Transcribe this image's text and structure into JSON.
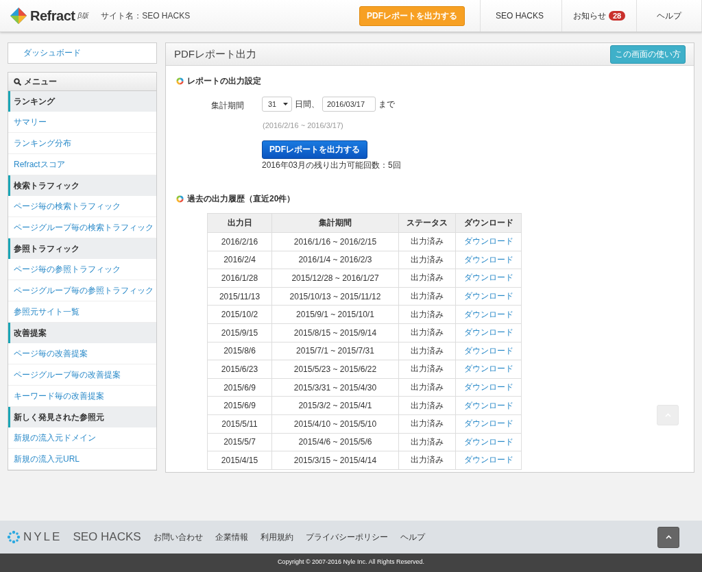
{
  "header": {
    "logo": "Refract",
    "edition": "β版",
    "site_label": "サイト名：SEO HACKS",
    "export_button": "PDFレポートを出力する",
    "nav": [
      {
        "label": "SEO HACKS",
        "kind": "dropdown"
      },
      {
        "label": "お知らせ",
        "kind": "badge",
        "badge": "28"
      },
      {
        "label": "ヘルプ",
        "kind": "plain"
      }
    ]
  },
  "sidebar": {
    "dashboard": "ダッシュボード",
    "menu_title": "メニュー",
    "sections": [
      {
        "title": "ランキング",
        "items": [
          "サマリー",
          "ランキング分布",
          "Refractスコア"
        ]
      },
      {
        "title": "検索トラフィック",
        "items": [
          "ページ毎の検索トラフィック",
          "ページグループ毎の検索トラフィック"
        ]
      },
      {
        "title": "参照トラフィック",
        "items": [
          "ページ毎の参照トラフィック",
          "ページグループ毎の参照トラフィック",
          "参照元サイト一覧"
        ]
      },
      {
        "title": "改善提案",
        "items": [
          "ページ毎の改善提案",
          "ページグループ毎の改善提案",
          "キーワード毎の改善提案"
        ]
      },
      {
        "title": "新しく発見された参照元",
        "items": [
          "新規の流入元ドメイン",
          "新規の流入元URL"
        ]
      }
    ]
  },
  "main": {
    "title": "PDFレポート出力",
    "help_button": "この画面の使い方",
    "settings": {
      "heading": "レポートの出力設定",
      "period_label": "集計期間",
      "days": "31",
      "days_suffix": "日間、",
      "date": "2016/03/17",
      "date_suffix": "まで",
      "range": "(2016/2/16 ~ 2016/3/17)",
      "button": "PDFレポートを出力する",
      "remaining": "2016年03月の残り出力可能回数：5回"
    },
    "history": {
      "heading": "過去の出力履歴（直近20件）",
      "columns": [
        "出力日",
        "集計期間",
        "ステータス",
        "ダウンロード"
      ],
      "rows": [
        [
          "2016/2/16",
          "2016/1/16 ~ 2016/2/15",
          "出力済み",
          "ダウンロード"
        ],
        [
          "2016/2/4",
          "2016/1/4 ~ 2016/2/3",
          "出力済み",
          "ダウンロード"
        ],
        [
          "2016/1/28",
          "2015/12/28 ~ 2016/1/27",
          "出力済み",
          "ダウンロード"
        ],
        [
          "2015/11/13",
          "2015/10/13 ~ 2015/11/12",
          "出力済み",
          "ダウンロード"
        ],
        [
          "2015/10/2",
          "2015/9/1 ~ 2015/10/1",
          "出力済み",
          "ダウンロード"
        ],
        [
          "2015/9/15",
          "2015/8/15 ~ 2015/9/14",
          "出力済み",
          "ダウンロード"
        ],
        [
          "2015/8/6",
          "2015/7/1 ~ 2015/7/31",
          "出力済み",
          "ダウンロード"
        ],
        [
          "2015/6/23",
          "2015/5/23 ~ 2015/6/22",
          "出力済み",
          "ダウンロード"
        ],
        [
          "2015/6/9",
          "2015/3/31 ~ 2015/4/30",
          "出力済み",
          "ダウンロード"
        ],
        [
          "2015/6/9",
          "2015/3/2 ~ 2015/4/1",
          "出力済み",
          "ダウンロード"
        ],
        [
          "2015/5/11",
          "2015/4/10 ~ 2015/5/10",
          "出力済み",
          "ダウンロード"
        ],
        [
          "2015/5/7",
          "2015/4/6 ~ 2015/5/6",
          "出力済み",
          "ダウンロード"
        ],
        [
          "2015/4/15",
          "2015/3/15 ~ 2015/4/14",
          "出力済み",
          "ダウンロード"
        ]
      ]
    }
  },
  "footer": {
    "brand": "NYLE",
    "brand2": "SEO HACKS",
    "links": [
      "お問い合わせ",
      "企業情報",
      "利用規約",
      "プライバシーポリシー",
      "ヘルプ"
    ],
    "copyright": "Copyright © 2007-2016 Nyle Inc. All Rights Reserved."
  }
}
